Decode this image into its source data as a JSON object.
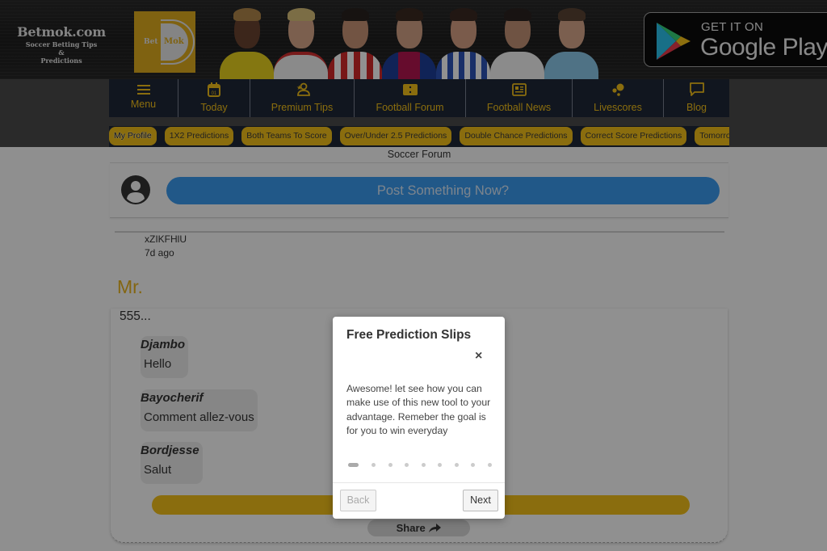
{
  "header": {
    "site_name": "Betmok.com",
    "tagline_1": "Soccer Betting Tips",
    "tagline_2": "&",
    "tagline_3": "Predictions",
    "logo_text_left": "Bet",
    "logo_text_right": "Mok",
    "google_play_small": "GET IT ON",
    "google_play_big": "Google Play"
  },
  "nav": {
    "items": [
      {
        "label": "Menu",
        "icon": "hamburger-icon"
      },
      {
        "label": "Today",
        "icon": "calendar-icon",
        "icon_text": "01"
      },
      {
        "label": "Premium Tips",
        "icon": "user-star-icon"
      },
      {
        "label": "Football Forum",
        "icon": "ticket-icon"
      },
      {
        "label": "Football News",
        "icon": "newspaper-icon"
      },
      {
        "label": "Livescores",
        "icon": "bubbles-icon"
      },
      {
        "label": "Blog",
        "icon": "chat-bubble-icon"
      }
    ]
  },
  "chips": [
    "My Profile",
    "1X2 Predictions",
    "Both Teams To Score",
    "Over/Under 2.5 Predictions",
    "Double Chance Predictions",
    "Correct Score Predictions",
    "Tomorrow Predictions"
  ],
  "forum": {
    "title": "Soccer Forum",
    "post_button": "Post Something Now?",
    "post": {
      "author": "xZIKFHlU",
      "ago": "7d ago",
      "title": "Mr.",
      "excerpt": "555...",
      "comments": [
        {
          "user": "Djambo",
          "text": "Hello"
        },
        {
          "user": "Bayocherif",
          "text": "Comment allez-vous"
        },
        {
          "user": "Bordjesse",
          "text": "Salut"
        }
      ],
      "share_label": "Share"
    }
  },
  "modal": {
    "title": "Free Prediction Slips",
    "close": "×",
    "body": "Awesome! let see how you can make use of this new tool to your advantage. Remeber the goal is for you to win everyday",
    "steps_total": 9,
    "step_current": 1,
    "back_label": "Back",
    "next_label": "Next"
  },
  "colors": {
    "accent_gold": "#f3c019",
    "nav_navy": "#1e2738",
    "post_blue": "#3a9bf0",
    "title_gold": "#e8b31e"
  }
}
